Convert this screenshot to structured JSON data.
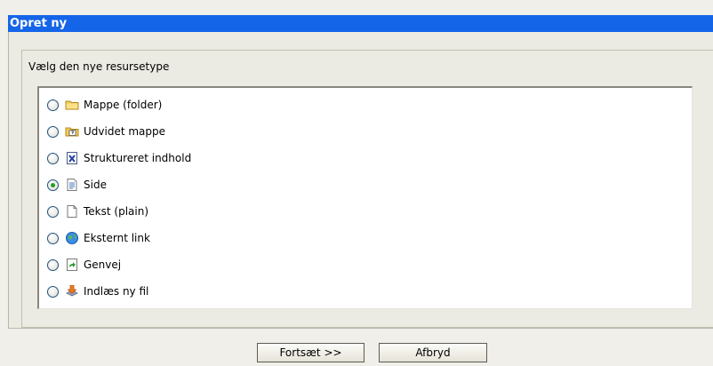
{
  "dialog": {
    "title": "Opret ny",
    "prompt": "Vælg den nye resursetype"
  },
  "resource_types": [
    {
      "label": "Mappe (folder)",
      "icon": "folder-icon",
      "selected": false
    },
    {
      "label": "Udvidet mappe",
      "icon": "extended-folder-icon",
      "selected": false
    },
    {
      "label": "Struktureret indhold",
      "icon": "structured-content-icon",
      "selected": false
    },
    {
      "label": "Side",
      "icon": "page-icon",
      "selected": true
    },
    {
      "label": "Tekst (plain)",
      "icon": "plain-text-icon",
      "selected": false
    },
    {
      "label": "Eksternt link",
      "icon": "external-link-icon",
      "selected": false
    },
    {
      "label": "Genvej",
      "icon": "shortcut-icon",
      "selected": false
    },
    {
      "label": "Indlæs ny fil",
      "icon": "upload-file-icon",
      "selected": false
    }
  ],
  "buttons": {
    "continue_label": "Fortsæt >>",
    "cancel_label": "Afbryd"
  },
  "colors": {
    "titlebar": "#1565e8",
    "background": "#ecebe3",
    "radio_selected": "#21a121"
  }
}
